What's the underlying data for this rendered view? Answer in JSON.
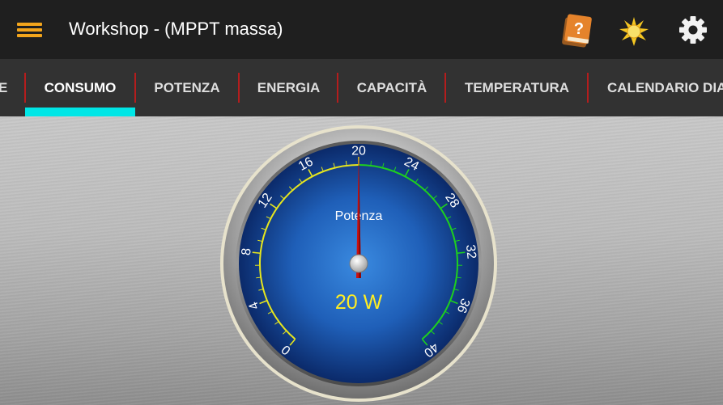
{
  "appbar": {
    "title": "Workshop - (MPPT massa)",
    "icons": [
      "menu-icon",
      "help-book-icon",
      "brightness-icon",
      "gear-icon"
    ],
    "accent_color": "#f3a51c"
  },
  "tabs": [
    {
      "label": "E",
      "active": false
    },
    {
      "label": "CONSUMO",
      "active": true
    },
    {
      "label": "POTENZA",
      "active": false
    },
    {
      "label": "ENERGIA",
      "active": false
    },
    {
      "label": "CAPACITÀ",
      "active": false
    },
    {
      "label": "TEMPERATURA",
      "active": false
    },
    {
      "label": "CALENDARIO DIA",
      "active": false
    }
  ],
  "tab_indicator_color": "#00e6e6",
  "gauge": {
    "label": "Potenza",
    "reading": "20 W",
    "value": 20,
    "min": 0,
    "max": 40,
    "ticks": [
      "0",
      "4",
      "8",
      "12",
      "16",
      "20",
      "24",
      "28",
      "32",
      "36",
      "40"
    ],
    "low_band_color": "#e6e61e",
    "high_band_color": "#1ed01e",
    "needle_color": "#cc1010",
    "reading_color": "#ffee22",
    "dial_color": "#1f5fb8"
  }
}
